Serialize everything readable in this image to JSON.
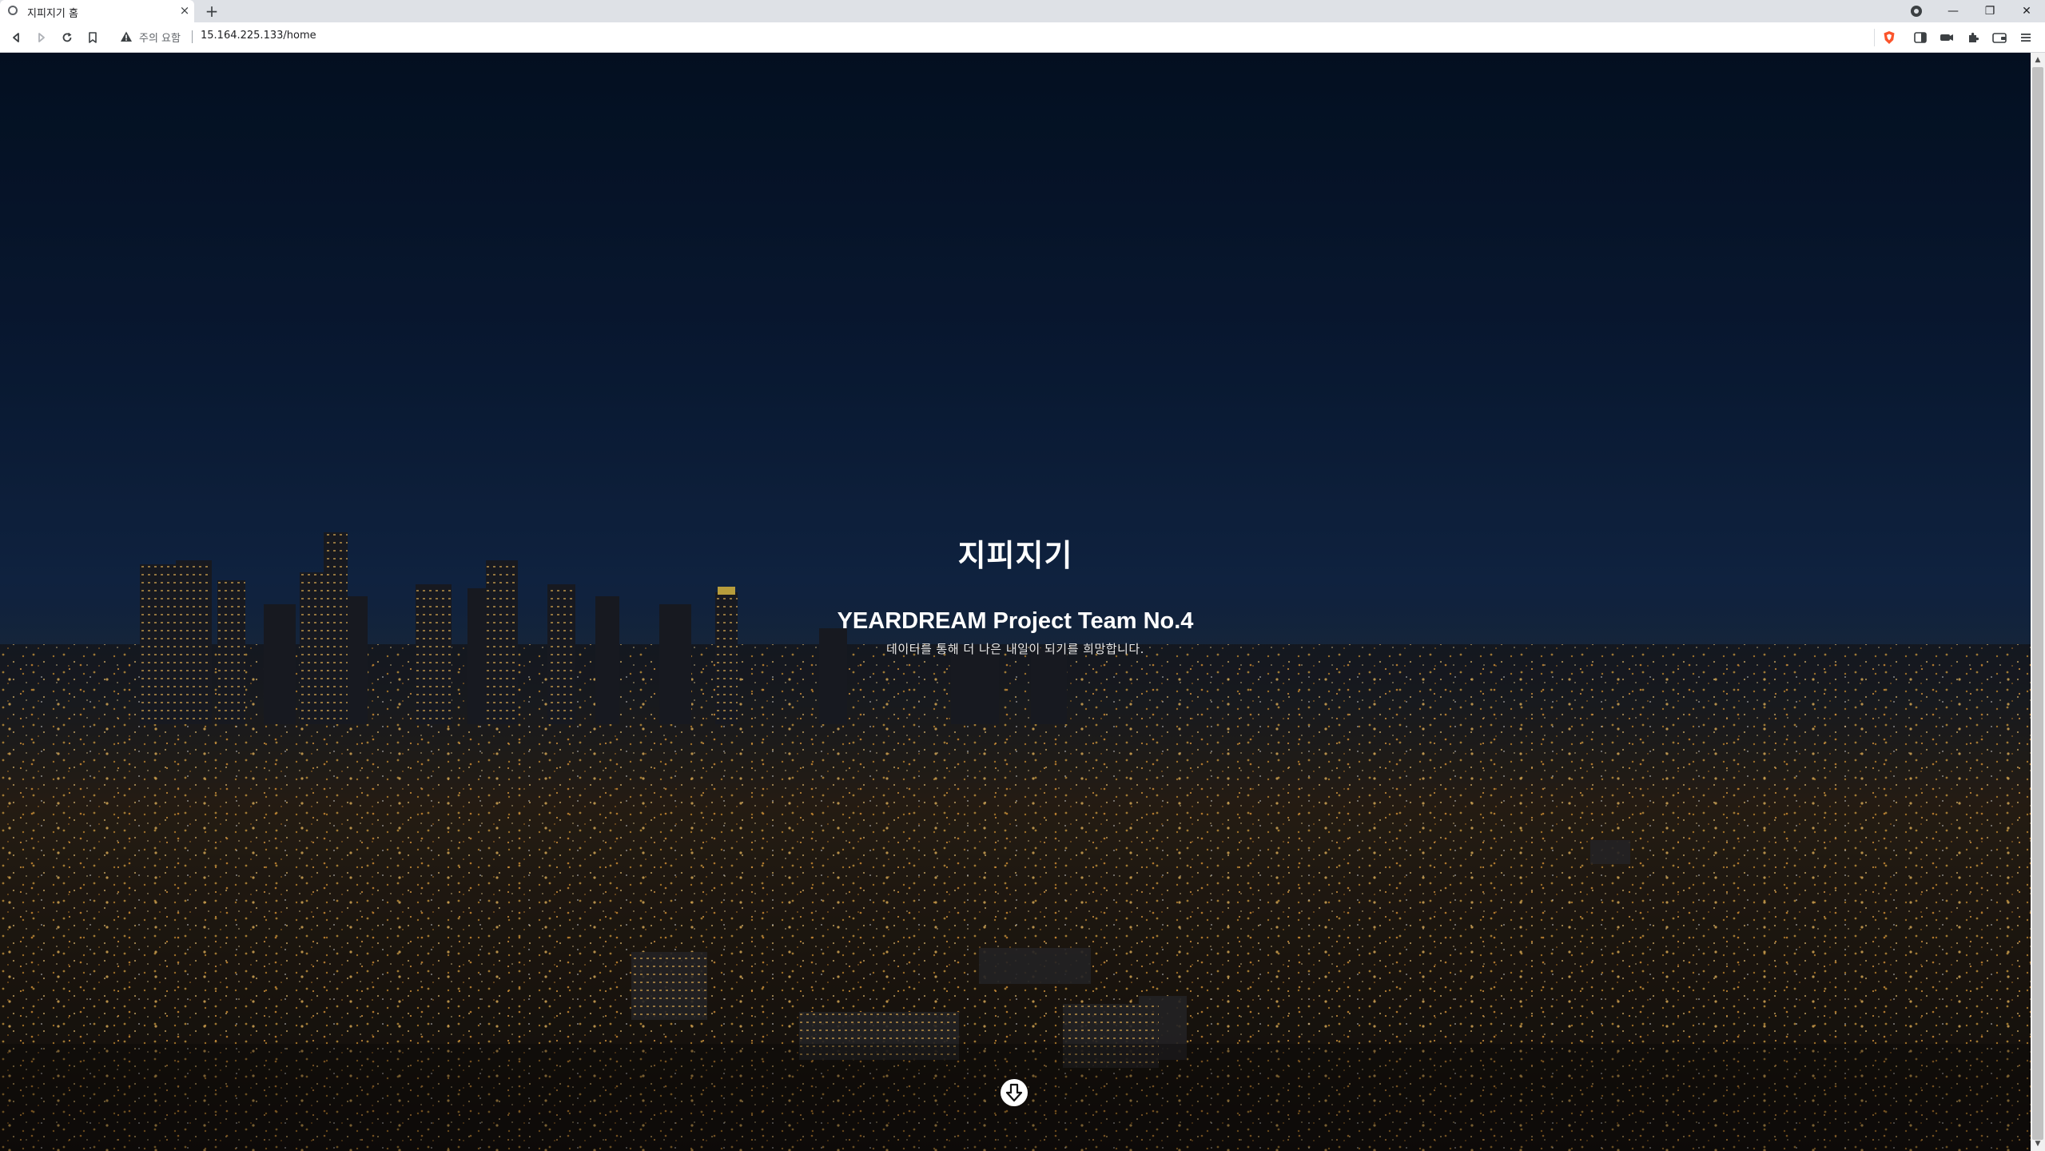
{
  "browser": {
    "tab_title": "지피지기 홈",
    "new_tab_label": "+",
    "close_tab_label": "×",
    "security_warning": "주의 요함",
    "url": "15.164.225.133/home",
    "window_controls": {
      "minimize": "—",
      "restore": "❐",
      "close": "✕"
    }
  },
  "hero": {
    "title": "지피지기",
    "subtitle": "YEARDREAM Project Team No.4",
    "description": "데이터를 통해 더 나은 내일이 되기를 희망합니다."
  },
  "scroll_arrows": {
    "up": "▲",
    "down": "▼"
  },
  "colors": {
    "sky_top": "#051328",
    "sky_horizon": "#132a4d",
    "city_lights": "#f5b94a",
    "hero_text": "#ffffff",
    "brave_orange": "#fb542b"
  },
  "icons": [
    "back-icon",
    "forward-icon",
    "reload-icon",
    "bookmark-icon",
    "warning-icon",
    "brave-shield-icon",
    "sidebar-icon",
    "wallet-icon",
    "extensions-icon",
    "leo-icon",
    "menu-icon",
    "scroll-down-icon"
  ]
}
